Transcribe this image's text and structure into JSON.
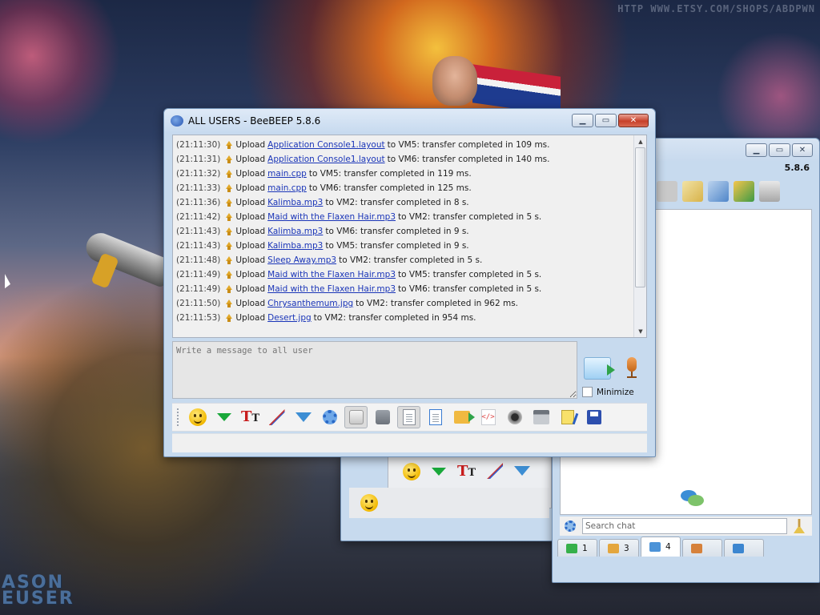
{
  "desktop": {
    "watermark": "HTTP WWW.ETSY.COM/SHOPS/ABDPWN",
    "logo_line1": "ASON",
    "logo_line2": "EUSER"
  },
  "main_window": {
    "title": "ALL USERS - BeeBEEP 5.8.6",
    "chat_lines": [
      {
        "time": "(21:11:30)",
        "action": "Upload",
        "file": "Application Console1.layout",
        "rest": "to VM5: transfer completed in 109 ms."
      },
      {
        "time": "(21:11:31)",
        "action": "Upload",
        "file": "Application Console1.layout",
        "rest": "to VM6: transfer completed in 140 ms."
      },
      {
        "time": "(21:11:32)",
        "action": "Upload",
        "file": "main.cpp",
        "rest": "to VM5: transfer completed in 119 ms."
      },
      {
        "time": "(21:11:33)",
        "action": "Upload",
        "file": "main.cpp",
        "rest": "to VM6: transfer completed in 125 ms."
      },
      {
        "time": "(21:11:36)",
        "action": "Upload",
        "file": "Kalimba.mp3",
        "rest": "to VM2: transfer completed in 8 s."
      },
      {
        "time": "(21:11:42)",
        "action": "Upload",
        "file": "Maid with the Flaxen Hair.mp3",
        "rest": "to VM2: transfer completed in 5 s."
      },
      {
        "time": "(21:11:43)",
        "action": "Upload",
        "file": "Kalimba.mp3",
        "rest": "to VM6: transfer completed in 9 s."
      },
      {
        "time": "(21:11:43)",
        "action": "Upload",
        "file": "Kalimba.mp3",
        "rest": "to VM5: transfer completed in 9 s."
      },
      {
        "time": "(21:11:48)",
        "action": "Upload",
        "file": "Sleep Away.mp3",
        "rest": "to VM2: transfer completed in 5 s."
      },
      {
        "time": "(21:11:49)",
        "action": "Upload",
        "file": "Maid with the Flaxen Hair.mp3",
        "rest": "to VM5: transfer completed in 5 s."
      },
      {
        "time": "(21:11:49)",
        "action": "Upload",
        "file": "Maid with the Flaxen Hair.mp3",
        "rest": "to VM6: transfer completed in 5 s."
      },
      {
        "time": "(21:11:50)",
        "action": "Upload",
        "file": "Chrysanthemum.jpg",
        "rest": "to VM2: transfer completed in 962 ms."
      },
      {
        "time": "(21:11:53)",
        "action": "Upload",
        "file": "Desert.jpg",
        "rest": "to VM2: transfer completed in 954 ms."
      }
    ],
    "message_placeholder": "Write a message to all user",
    "minimize_label": "Minimize",
    "toolbar_icons": [
      "emoticon-icon",
      "green-arrow-down-icon",
      "font-icon",
      "color-icon",
      "filter-icon",
      "settings-gear-icon",
      "spellcheck-icon",
      "dictionary-icon",
      "word-complete-icon",
      "save-chat-icon",
      "send-file-icon",
      "html-code-icon",
      "screenshot-icon",
      "calendar-icon",
      "edit-note-icon",
      "save-icon"
    ]
  },
  "side_window": {
    "version": "5.8.6",
    "search_placeholder": "Search chat",
    "tabs": [
      {
        "label": "1",
        "icon": "users-online-icon"
      },
      {
        "label": "3",
        "icon": "groups-icon"
      },
      {
        "label": "4",
        "icon": "chats-icon"
      },
      {
        "label": "",
        "icon": "network-icon"
      },
      {
        "label": "",
        "icon": "pin-icon"
      }
    ]
  },
  "colors": {
    "link": "#1a35b8",
    "titlebar": "#c7daee",
    "close_button": "#c7402b"
  }
}
